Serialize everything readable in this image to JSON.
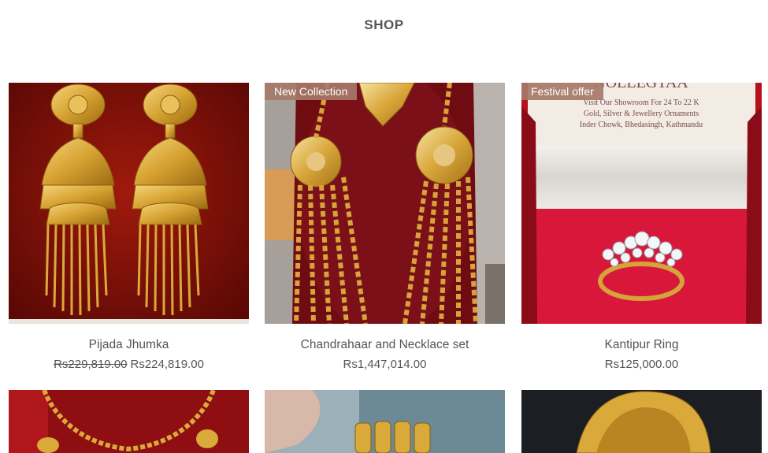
{
  "page": {
    "title": "SHOP"
  },
  "products": [
    {
      "name": "Pijada Jhumka",
      "old_price": "Rs229,819.00",
      "price": "Rs224,819.00",
      "badge": ""
    },
    {
      "name": "Chandrahaar and Necklace set",
      "old_price": "",
      "price": "Rs1,447,014.00",
      "badge": "New Collection"
    },
    {
      "name": "Kantipur Ring",
      "old_price": "",
      "price": "Rs125,000.00",
      "badge": "Festival offer"
    }
  ],
  "ring_box_text": [
    "Visit Our Showroom For 24 To 22 K",
    "Gold, Silver & Jewellery Ornaments",
    "Inder Chowk, Bhedasingh, Kathmandu"
  ],
  "colors": {
    "badge_bg": "#a67868",
    "text": "#555555",
    "velvet_red": "#8a0c0c",
    "gold": "#d9a93a"
  }
}
